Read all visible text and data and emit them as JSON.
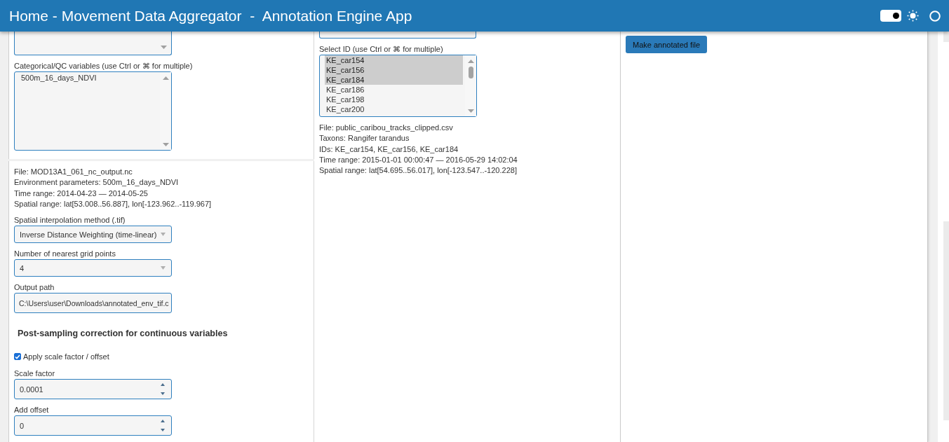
{
  "header": {
    "title": "Home - Movement Data Aggregator  -  Annotation Engine App",
    "theme_toggle": {
      "on": true
    }
  },
  "left_panel": {
    "categorical_variables": {
      "label": "Categorical/QC variables (use Ctrl or ⌘ for multiple)",
      "options": [
        {
          "label": "500m_16_days_NDVI",
          "selected": false
        }
      ]
    },
    "file_info": [
      "File: MOD13A1_061_nc_output.nc",
      "Environment parameters: 500m_16_days_NDVI",
      "Time range: 2014-04-23 — 2014-05-25",
      "Spatial range: lat[53.008..56.887], lon[-123.962..-119.967]"
    ],
    "interpolation_method": {
      "label": "Spatial interpolation method (.tif)",
      "value": "Inverse Distance Weighting (time-linear)"
    },
    "nearest_grid_points": {
      "label": "Number of nearest grid points",
      "value": "4"
    },
    "output_path": {
      "label": "Output path",
      "value": "C:\\Users\\user\\Downloads\\annotated_env_tif.c"
    },
    "correction": {
      "heading": "Post-sampling correction for continuous variables",
      "apply_scale": {
        "label": "Apply scale factor / offset",
        "checked": true
      },
      "scale_factor": {
        "label": "Scale factor",
        "value": "0.0001"
      },
      "add_offset": {
        "label": "Add offset",
        "value": "0"
      }
    }
  },
  "middle_panel": {
    "select_id": {
      "label": "Select ID (use Ctrl or ⌘ for multiple)",
      "options": [
        {
          "label": "KE_car154",
          "selected": true
        },
        {
          "label": "KE_car156",
          "selected": true
        },
        {
          "label": "KE_car184",
          "selected": true
        },
        {
          "label": "KE_car186",
          "selected": false
        },
        {
          "label": "KE_car198",
          "selected": false
        },
        {
          "label": "KE_car200",
          "selected": false
        }
      ]
    },
    "track_info": [
      "File: public_caribou_tracks_clipped.csv",
      "Taxons: Rangifer tarandus",
      "IDs: KE_car154, KE_car156, KE_car184",
      "Time range: 2015-01-01 00:00:47 — 2016-05-29 14:02:04",
      "Spatial range: lat[54.695..56.017], lon[-123.547..-120.228]"
    ]
  },
  "right_panel": {
    "make_button": "Make annotated file"
  }
}
